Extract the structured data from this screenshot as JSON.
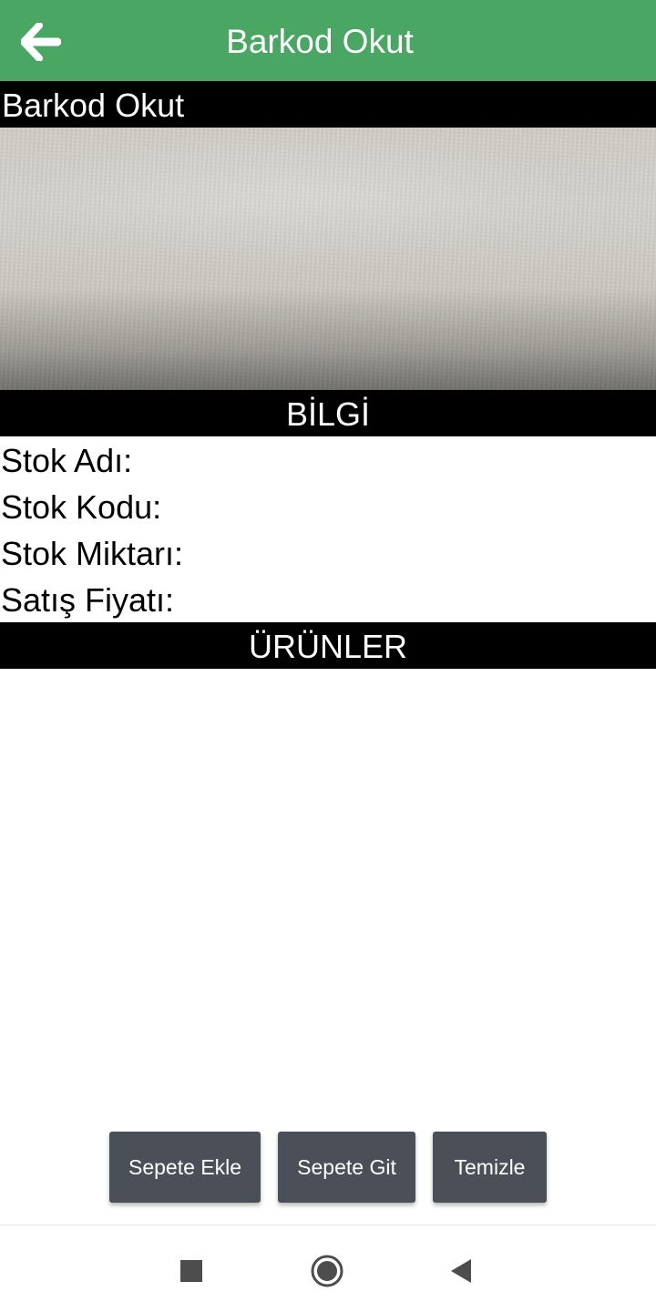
{
  "app_bar": {
    "title": "Barkod Okut",
    "back_icon": "arrow-left-icon",
    "background_color": "#4aa763"
  },
  "scanner": {
    "header": "Barkod Okut"
  },
  "info": {
    "header": "BİLGİ",
    "rows": [
      {
        "label": "Stok Adı:",
        "value": ""
      },
      {
        "label": "Stok Kodu:",
        "value": ""
      },
      {
        "label": "Stok Miktarı:",
        "value": ""
      },
      {
        "label": "Satış Fiyatı:",
        "value": ""
      }
    ]
  },
  "products": {
    "header": "ÜRÜNLER",
    "items": []
  },
  "actions": {
    "add_to_cart": "Sepete Ekle",
    "go_to_cart": "Sepete Git",
    "clear": "Temizle",
    "button_color": "#4b5058"
  },
  "system_nav": {
    "recents_icon": "square-recents-icon",
    "home_icon": "circle-home-icon",
    "back_icon": "triangle-back-icon"
  }
}
